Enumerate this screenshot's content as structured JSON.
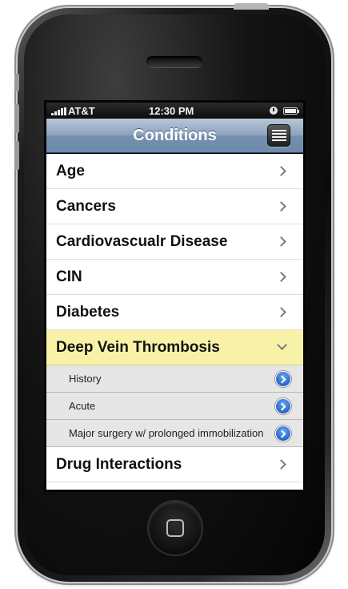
{
  "status_bar": {
    "carrier": "AT&T",
    "time": "12:30 PM"
  },
  "nav": {
    "title": "Conditions"
  },
  "list": {
    "rows_before": [
      {
        "label": "Age"
      },
      {
        "label": "Cancers"
      },
      {
        "label": "Cardiovascualr Disease"
      },
      {
        "label": "CIN"
      },
      {
        "label": "Diabetes"
      }
    ],
    "expanded": {
      "label": "Deep Vein Thrombosis",
      "subitems": [
        {
          "label": "History"
        },
        {
          "label": "Acute"
        },
        {
          "label": "Major surgery w/ prolonged immobilization"
        }
      ]
    },
    "rows_after": [
      {
        "label": "Drug Interactions"
      }
    ]
  },
  "icons": {
    "row_chevron": "chevron-right-icon",
    "expanded_chevron": "chevron-down-icon",
    "sub_action": "detail-disclosure-icon",
    "nav_button": "list-icon"
  },
  "colors": {
    "navbar": "#7f98b6",
    "expanded_row": "#f8f2a8",
    "subrow": "#e6e6e6",
    "disclosure": "#2f6fd1"
  }
}
